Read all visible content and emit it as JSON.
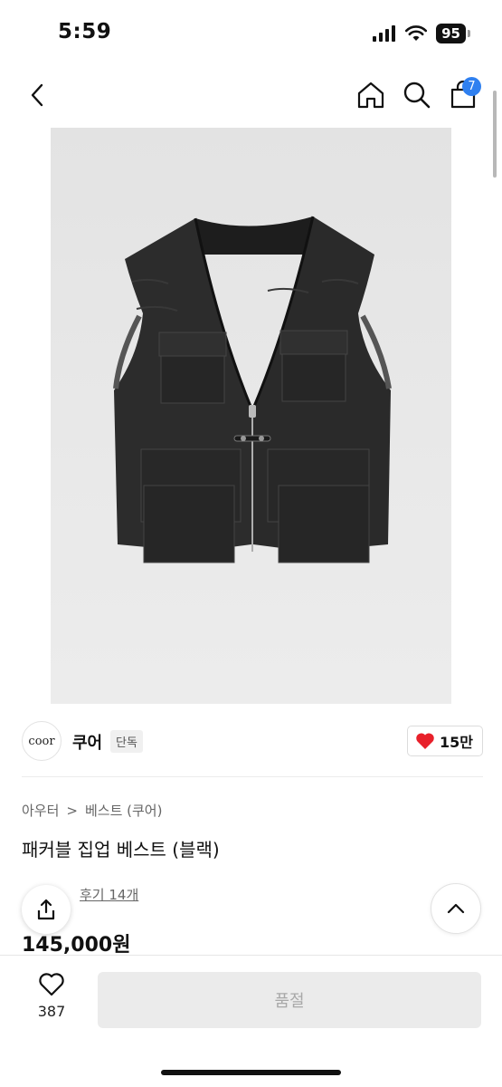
{
  "status": {
    "time": "5:59",
    "battery": "95"
  },
  "nav": {
    "cart_count": "7"
  },
  "brand": {
    "logo_text": "coor",
    "name": "쿠어",
    "badge": "단독",
    "likes": "15만"
  },
  "breadcrumb": {
    "category": "아우터",
    "separator": ">",
    "subcategory": "베스트 (쿠어)"
  },
  "product": {
    "title": "패커블 집업 베스트 (블랙)",
    "review_text": "후기 14개",
    "price": "145,000원"
  },
  "bottom": {
    "wish_count": "387",
    "buy_label": "품절"
  },
  "colors": {
    "accent": "#2f80f0",
    "heart": "#e8202a",
    "vest": "#2a2a2a"
  }
}
